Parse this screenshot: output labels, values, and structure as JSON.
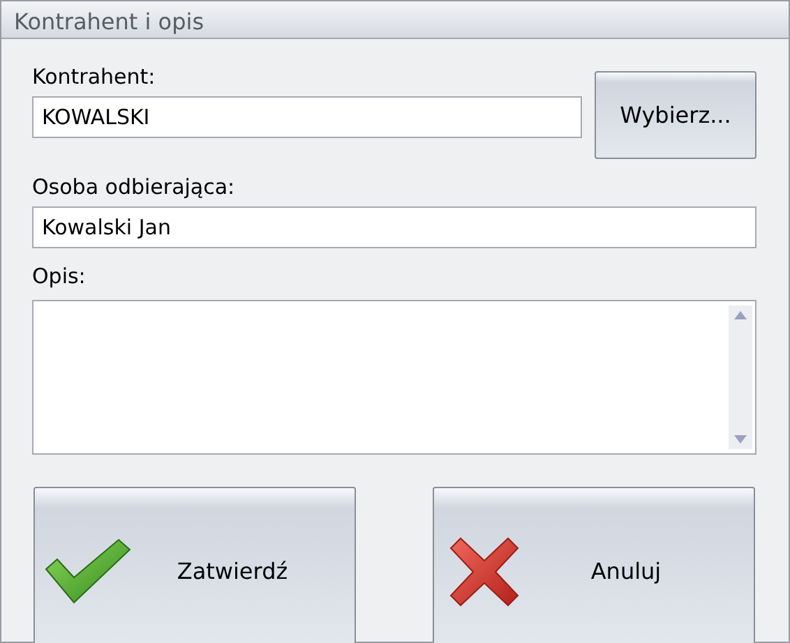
{
  "window": {
    "title": "Kontrahent i opis"
  },
  "contractor": {
    "label": "Kontrahent:",
    "value": "KOWALSKI",
    "button": "Wybierz..."
  },
  "recipient": {
    "label": "Osoba odbierająca:",
    "value": "Kowalski Jan"
  },
  "description": {
    "label": "Opis:"
  },
  "buttons": [
    {
      "kind": "confirm",
      "label": "Zatwierdź"
    },
    {
      "kind": "cancel",
      "label": "Anuluj"
    }
  ]
}
